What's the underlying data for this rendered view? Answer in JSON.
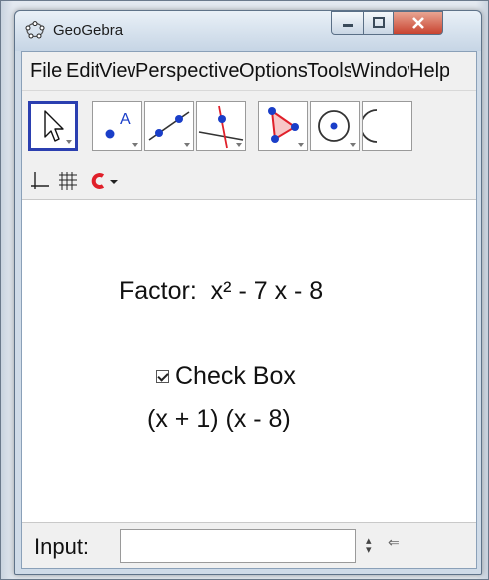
{
  "window": {
    "title": "GeoGebra",
    "controls": {
      "minimize": "—",
      "maximize": "☐",
      "close": "✕"
    }
  },
  "menu": {
    "items": [
      {
        "label": "File"
      },
      {
        "label": "Edit"
      },
      {
        "label": "View"
      },
      {
        "label": "Perspectives"
      },
      {
        "label": "Options"
      },
      {
        "label": "Tools"
      },
      {
        "label": "Window"
      },
      {
        "label": "Help"
      }
    ]
  },
  "toolbar": {
    "tools": [
      {
        "icon": "move-tool-icon",
        "selected": true
      },
      {
        "icon": "point-tool-icon",
        "point_label": "A"
      },
      {
        "icon": "line-tool-icon"
      },
      {
        "icon": "perpendicular-line-tool-icon"
      },
      {
        "icon": "polygon-tool-icon"
      },
      {
        "icon": "circle-tool-icon"
      },
      {
        "icon": "angle-tool-icon"
      }
    ]
  },
  "stylebar": {
    "icons": [
      "axes-icon",
      "grid-icon",
      "point-capturing-icon",
      "dropdown-arrow-icon"
    ],
    "accent_color": "#e0202a"
  },
  "graphics": {
    "factor_text": "Factor:  x² - 7 x - 8",
    "checkbox": {
      "label": "Check Box",
      "checked": true
    },
    "answer_text": "(x + 1) (x - 8)"
  },
  "input_bar": {
    "label": "Input:",
    "value": "",
    "placeholder": ""
  },
  "colors": {
    "selection_border": "#2b3fb0",
    "point_blue": "#1a3ec8",
    "line_red": "#e0202a",
    "window_frame": "#cfdbe8"
  }
}
